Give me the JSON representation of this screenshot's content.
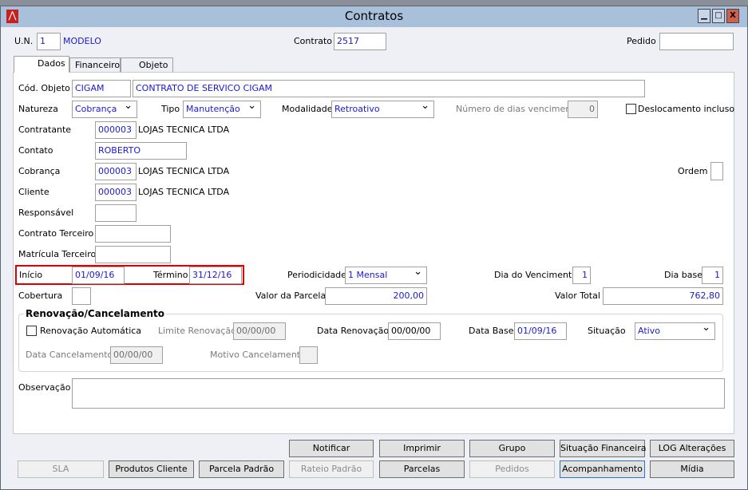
{
  "window": {
    "title": "Contratos",
    "minimize": "▁",
    "maximize": "□",
    "close": "X"
  },
  "header": {
    "un_label": "U.N.",
    "un_value": "1",
    "un_name": "MODELO",
    "contrato_label": "Contrato",
    "contrato_value": "2517",
    "pedido_label": "Pedido",
    "pedido_value": ""
  },
  "tabs": [
    {
      "label": "Dados"
    },
    {
      "label": "Financeiro"
    },
    {
      "label": "Objeto"
    }
  ],
  "form": {
    "cod_objeto_label": "Cód. Objeto",
    "cod_objeto_value": "CIGAM",
    "cod_objeto_desc": "CONTRATO DE SERVICO CIGAM",
    "natureza_label": "Natureza",
    "natureza_value": "Cobrança",
    "tipo_label": "Tipo",
    "tipo_value": "Manutenção",
    "modalidade_label": "Modalidade",
    "modalidade_value": "Retroativo",
    "dias_venc_label": "Número de dias vencimento",
    "dias_venc_value": "0",
    "deslocamento_label": "Deslocamento incluso",
    "contratante_label": "Contratante",
    "contratante_code": "000003",
    "contratante_name": "LOJAS  TECNICA LTDA",
    "contato_label": "Contato",
    "contato_value": "ROBERTO",
    "cobranca_label": "Cobrança",
    "cobranca_code": "000003",
    "cobranca_name": "LOJAS  TECNICA LTDA",
    "ordem_label": "Ordem",
    "cliente_label": "Cliente",
    "cliente_code": "000003",
    "cliente_name": "LOJAS  TECNICA LTDA",
    "responsavel_label": "Responsável",
    "contrato_terceiro_label": "Contrato Terceiro",
    "matricula_label": "Matrícula Terceiro",
    "inicio_label": "Início",
    "inicio_value": "01/09/16",
    "termino_label": "Término",
    "termino_value": "31/12/16",
    "periodicidade_label": "Periodicidade",
    "periodicidade_value": "1 Mensal",
    "dia_venc_label": "Dia do Vencimento",
    "dia_venc_value": "1",
    "dia_base_label": "Dia base",
    "dia_base_value": "1",
    "cobertura_label": "Cobertura",
    "valor_parcela_label": "Valor da Parcela",
    "valor_parcela_value": "200,00",
    "valor_total_label": "Valor Total",
    "valor_total_value": "762,80",
    "observacao_label": "Observação"
  },
  "renovacao": {
    "title": "Renovação/Cancelamento",
    "auto_label": "Renovação Automática",
    "limite_label": "Limite Renovação",
    "limite_value": "00/00/00",
    "data_renov_label": "Data Renovação",
    "data_renov_value": "00/00/00",
    "data_base_label": "Data Base",
    "data_base_value": "01/09/16",
    "situacao_label": "Situação",
    "situacao_value": "Ativo",
    "data_cancel_label": "Data Cancelamento",
    "data_cancel_value": "00/00/00",
    "motivo_label": "Motivo Cancelamento"
  },
  "buttons": {
    "notificar": "Notificar",
    "imprimir": "Imprimir",
    "grupo": "Grupo",
    "situacao_fin": "Situação Financeira",
    "log": "LOG Alterações",
    "sla": "SLA",
    "produtos": "Produtos Cliente",
    "parcela_padrao": "Parcela Padrão",
    "rateio": "Rateio Padrão",
    "parcelas": "Parcelas",
    "pedidos": "Pedidos",
    "acompanhamento": "Acompanhamento",
    "midia": "Mídia"
  },
  "colors": {
    "title_bar": "#a9c0da",
    "highlight": "#e00000",
    "value_text": "#1a1ad0"
  }
}
